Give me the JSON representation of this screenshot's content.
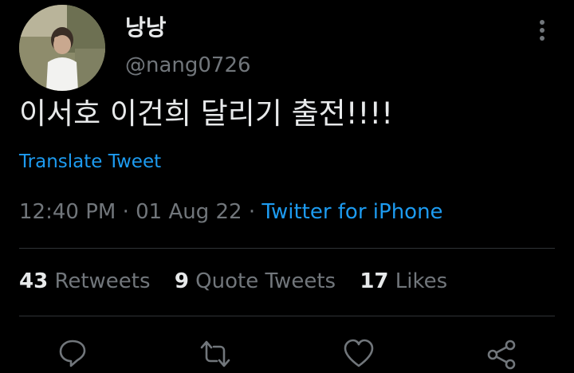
{
  "user": {
    "display_name": "낭낭",
    "handle": "@nang0726",
    "avatar": "profile-photo"
  },
  "tweet": {
    "text": "이서호 이건희 달리기 출전!!!!",
    "translate_label": "Translate Tweet",
    "time": "12:40 PM",
    "date": "01 Aug 22",
    "separator": "·",
    "source": "Twitter for iPhone"
  },
  "stats": [
    {
      "count": "43",
      "label": "Retweets"
    },
    {
      "count": "9",
      "label": "Quote Tweets"
    },
    {
      "count": "17",
      "label": "Likes"
    }
  ],
  "actions": [
    "reply-icon",
    "retweet-icon",
    "like-icon",
    "share-icon"
  ],
  "menu": {
    "icon": "more-vertical-icon"
  },
  "colors": {
    "background": "#000000",
    "text_primary": "#e7e9ea",
    "text_secondary": "#71767b",
    "accent": "#1d9bf0",
    "divider": "#2f3336"
  }
}
